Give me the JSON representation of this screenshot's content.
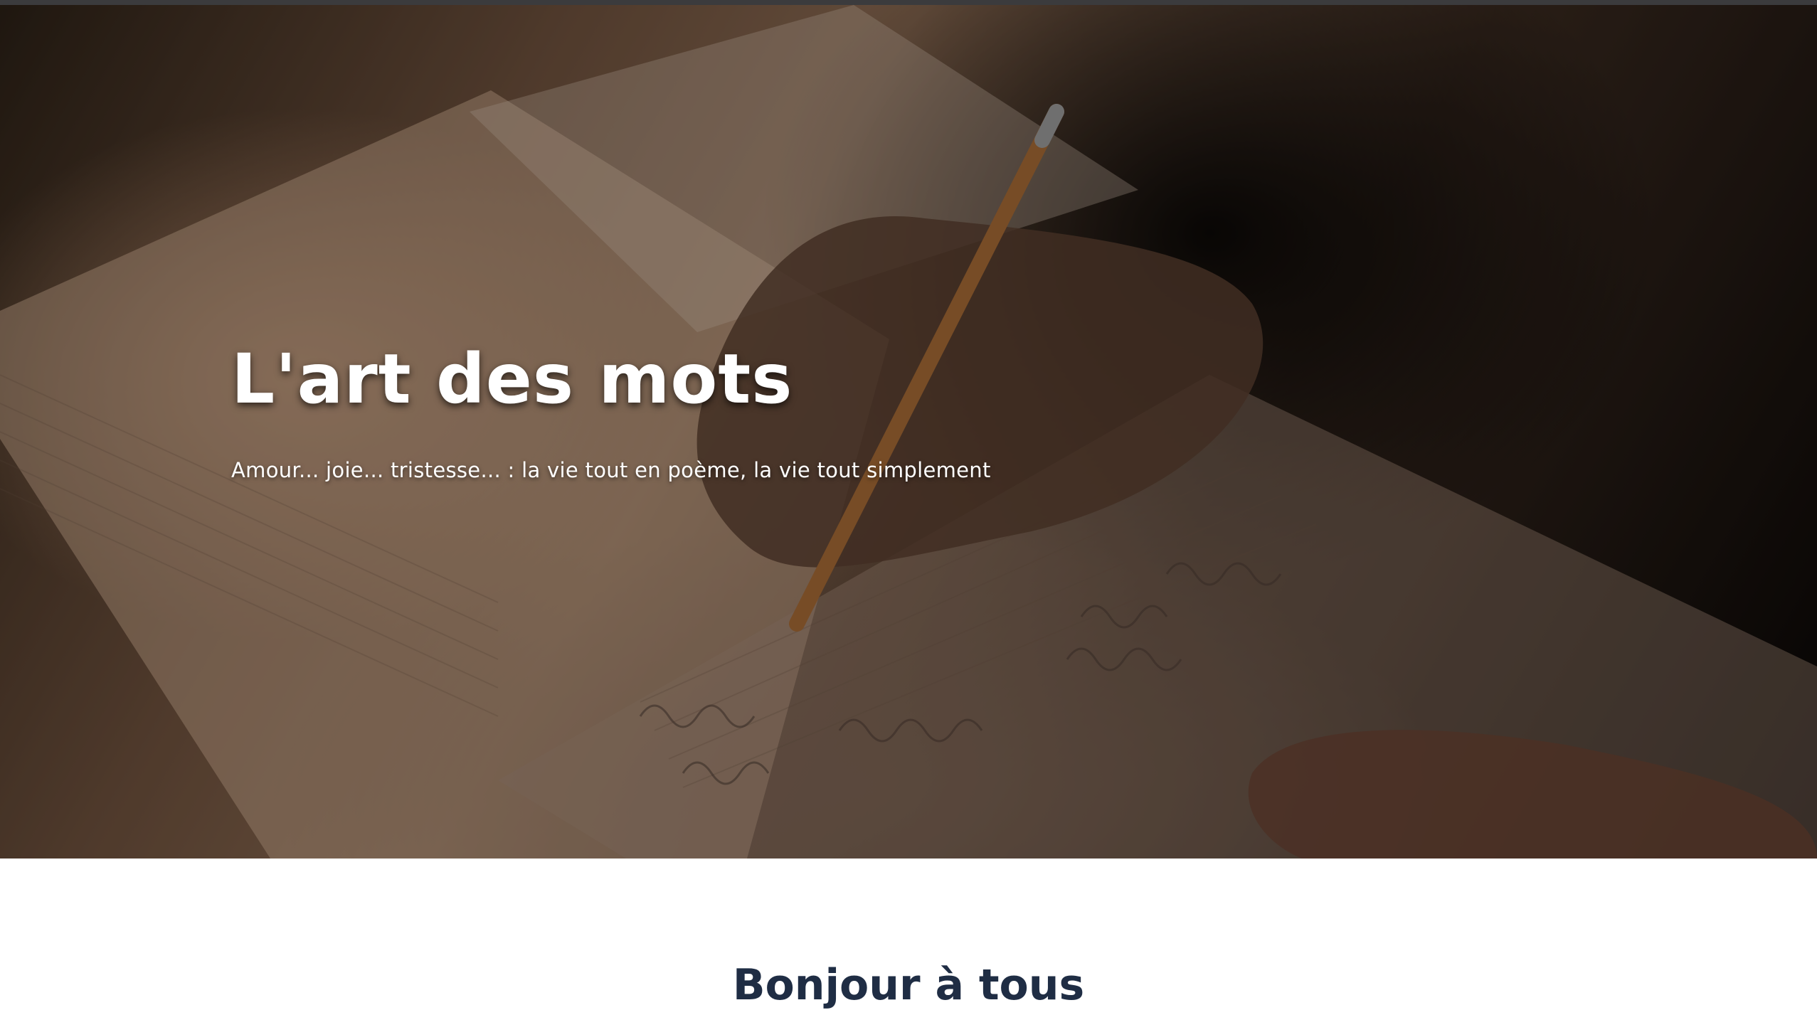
{
  "hero": {
    "title": "L'art des mots",
    "subtitle": "Amour... joie... tristesse... : la vie tout en poème, la vie tout simplement"
  },
  "main": {
    "section_heading": "Bonjour à tous"
  },
  "colors": {
    "title_text": "#ffffff",
    "section_heading": "#1f2d44",
    "top_bar": "#3b3b3d",
    "page_background": "#ffffff"
  }
}
